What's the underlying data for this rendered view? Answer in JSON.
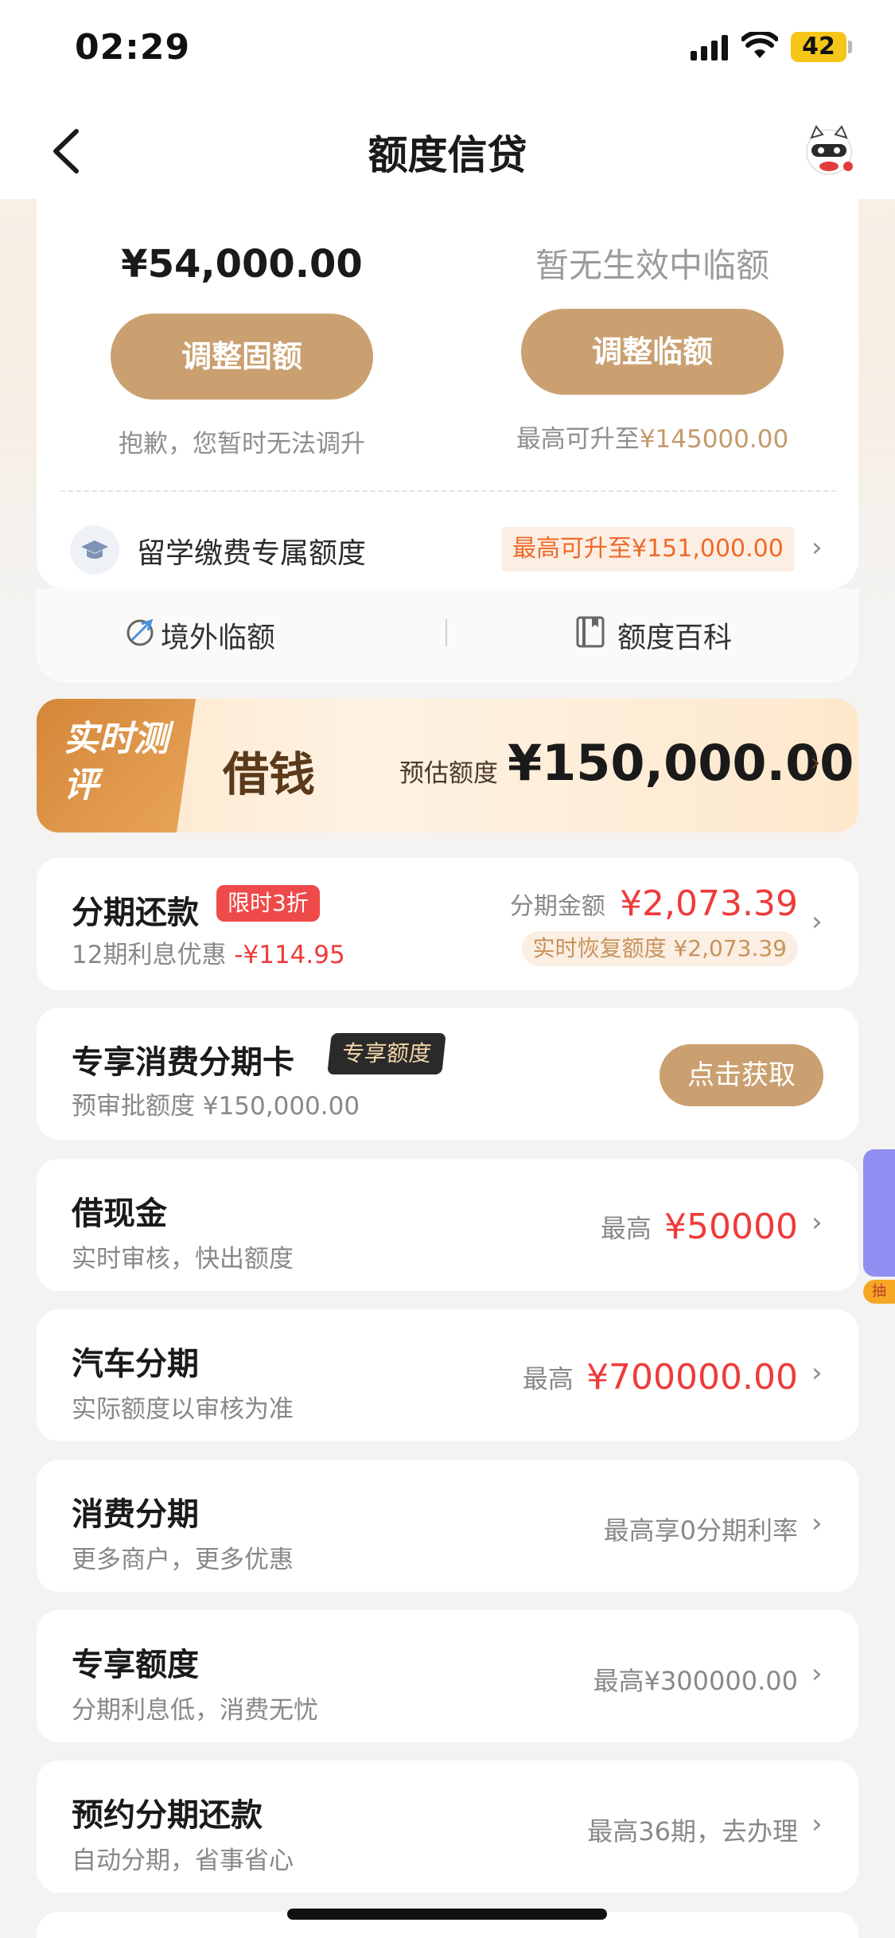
{
  "status": {
    "time": "02:29",
    "battery": "42"
  },
  "nav": {
    "title": "额度信贷"
  },
  "quota": {
    "fixed_amount": "¥54,000.00",
    "fixed_button": "调整固额",
    "fixed_hint": "抱歉，您暂时无法调升",
    "temp_status": "暂无生效中临额",
    "temp_button": "调整临额",
    "temp_hint_prefix": "最高可升至",
    "temp_hint_amount": "¥145000.00",
    "study_label": "留学缴费专属额度",
    "study_tag": "最高可升至¥151,000.00"
  },
  "subbar": {
    "overseas": "境外临额",
    "wiki": "额度百科"
  },
  "borrow": {
    "tag": "实时测评",
    "title": "借钱",
    "est_label": "预估额度",
    "amount": "¥150,000.00"
  },
  "cards": {
    "installment": {
      "title": "分期还款",
      "badge": "限时3折",
      "sub_prefix": "12期利息优惠",
      "sub_amount": "-¥114.95",
      "right_label": "分期金额",
      "right_amount": "¥2,073.39",
      "restore": "实时恢复额度 ¥2,073.39"
    },
    "card_offer": {
      "title": "专享消费分期卡",
      "badge": "专享额度",
      "sub": "预审批额度 ¥150,000.00",
      "button": "点击获取"
    },
    "cash": {
      "title": "借现金",
      "sub": "实时审核，快出额度",
      "right_label": "最高",
      "right_amount": "¥50000"
    },
    "car": {
      "title": "汽车分期",
      "sub": "实际额度以审核为准",
      "right_label": "最高",
      "right_amount": "¥700000.00"
    },
    "consume": {
      "title": "消费分期",
      "sub": "更多商户，更多优惠",
      "right": "最高享0分期利率"
    },
    "exclusive": {
      "title": "专享额度",
      "sub": "分期利息低，消费无忧",
      "right": "最高¥300000.00"
    },
    "reserve": {
      "title": "预约分期还款",
      "sub": "自动分期，省事省心",
      "right": "最高36期，去办理"
    }
  },
  "side_float": {
    "label": "抽"
  },
  "colors": {
    "gold": "#caa071",
    "red": "#ee3b3b",
    "orange": "#ee6a2a"
  }
}
